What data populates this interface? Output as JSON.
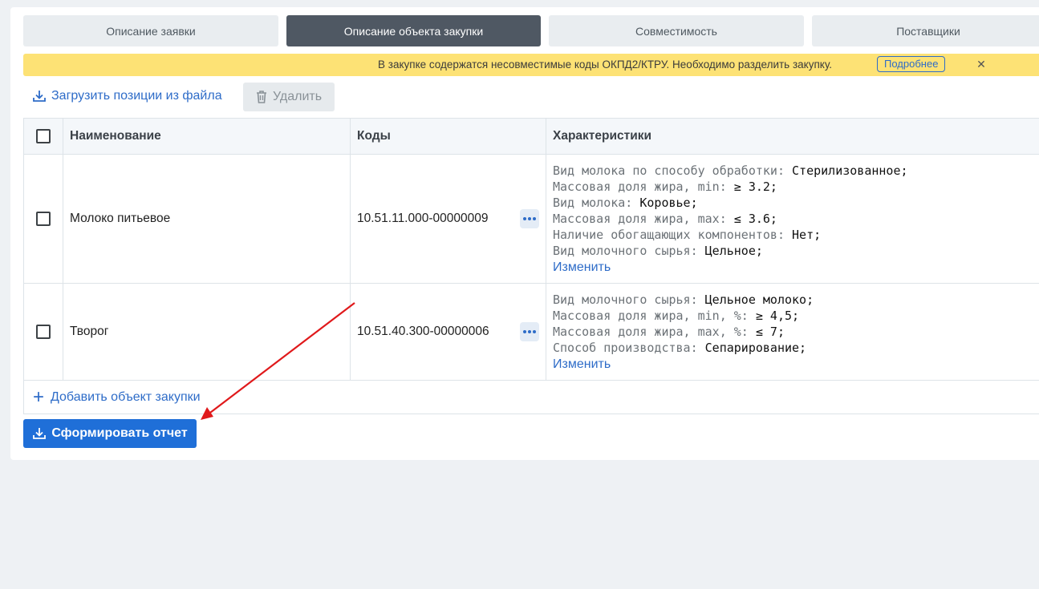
{
  "tabs": [
    {
      "label": "Описание заявки"
    },
    {
      "label": "Описание объекта закупки"
    },
    {
      "label": "Совместимость"
    },
    {
      "label": "Поставщики"
    }
  ],
  "banner": {
    "text": "В закупке содержатся несовместимые коды ОКПД2/КТРУ. Необходимо разделить закупку.",
    "more_label": "Подробнее",
    "close": "✕"
  },
  "toolbar": {
    "upload_label": "Загрузить позиции из файла",
    "delete_label": "Удалить"
  },
  "table": {
    "headers": {
      "name": "Наименование",
      "codes": "Коды",
      "chars": "Характеристики"
    },
    "rows": [
      {
        "name": "Молоко питьевое",
        "code": "10.51.11.000-00000009",
        "chars": [
          {
            "k": "Вид молока по способу обработки:",
            "v": "Стерилизованное;"
          },
          {
            "k": "Массовая доля жира, min:",
            "v": "≥ 3.2;"
          },
          {
            "k": "Вид молока:",
            "v": "Коровье;"
          },
          {
            "k": "Массовая доля жира, max:",
            "v": "≤ 3.6;"
          },
          {
            "k": "Наличие обогащающих компонентов:",
            "v": "Нет;"
          },
          {
            "k": "Вид молочного сырья:",
            "v": "Цельное;"
          }
        ],
        "edit": "Изменить"
      },
      {
        "name": "Творог",
        "code": "10.51.40.300-00000006",
        "chars": [
          {
            "k": "Вид молочного сырья:",
            "v": "Цельное молоко;"
          },
          {
            "k": "Массовая доля жира, min, %:",
            "v": "≥ 4,5;"
          },
          {
            "k": "Массовая доля жира, max, %:",
            "v": "≤ 7;"
          },
          {
            "k": "Способ производства:",
            "v": "Сепарирование;"
          }
        ],
        "edit": "Изменить"
      }
    ],
    "add_label": "Добавить объект закупки"
  },
  "report_button": {
    "label": "Сформировать отчет"
  },
  "colors": {
    "accent": "#1f6fd8",
    "link": "#2e6cc8",
    "banner": "#fde275",
    "active_tab": "#4f5863",
    "arrow": "#e0191b"
  }
}
